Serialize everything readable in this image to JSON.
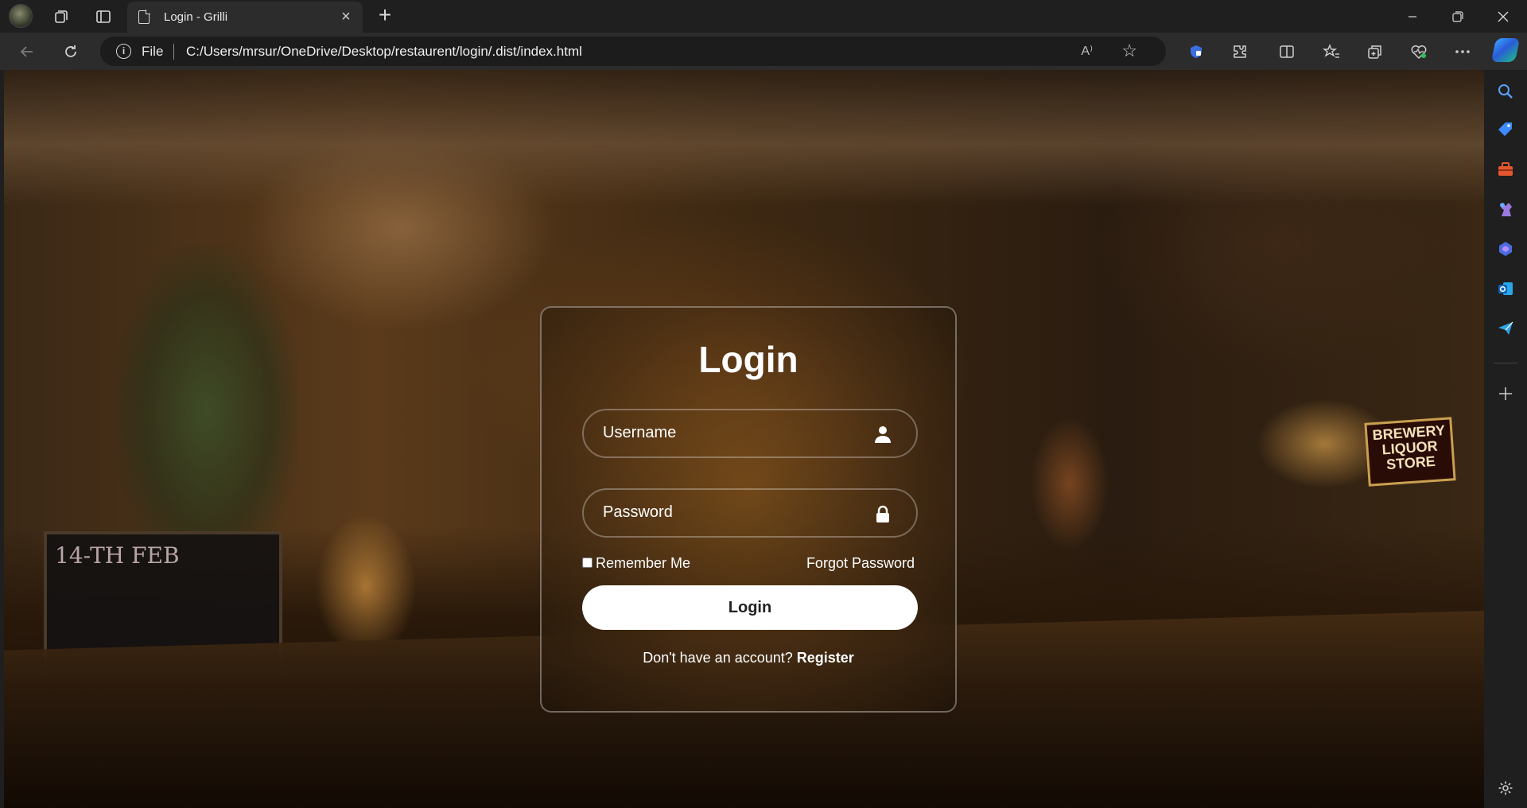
{
  "browser": {
    "tab_title": "Login - Grilli",
    "tab_close": "×",
    "new_tab": "+",
    "address": {
      "scheme_label": "File",
      "url": "C:/Users/mrsur/OneDrive/Desktop/restaurent/login/.dist/index.html",
      "read_aloud": "A⁾"
    }
  },
  "page": {
    "scene_signs": {
      "store": "BREWERY LIQUOR STORE",
      "chalkboard": "14-TH FEB"
    },
    "login_card": {
      "title": "Login",
      "username_placeholder": "Username",
      "password_placeholder": "Password",
      "remember_label": "Remember Me",
      "forgot_label": "Forgot Password",
      "submit_label": "Login",
      "no_account_text": "Don't have an account?",
      "register_label": "Register"
    }
  },
  "colors": {
    "browser_bg": "#1f1f1f",
    "toolbar_bg": "#2c2c2c",
    "button_bg": "#ffffff",
    "button_text": "#222222",
    "card_text": "#ffffff"
  }
}
